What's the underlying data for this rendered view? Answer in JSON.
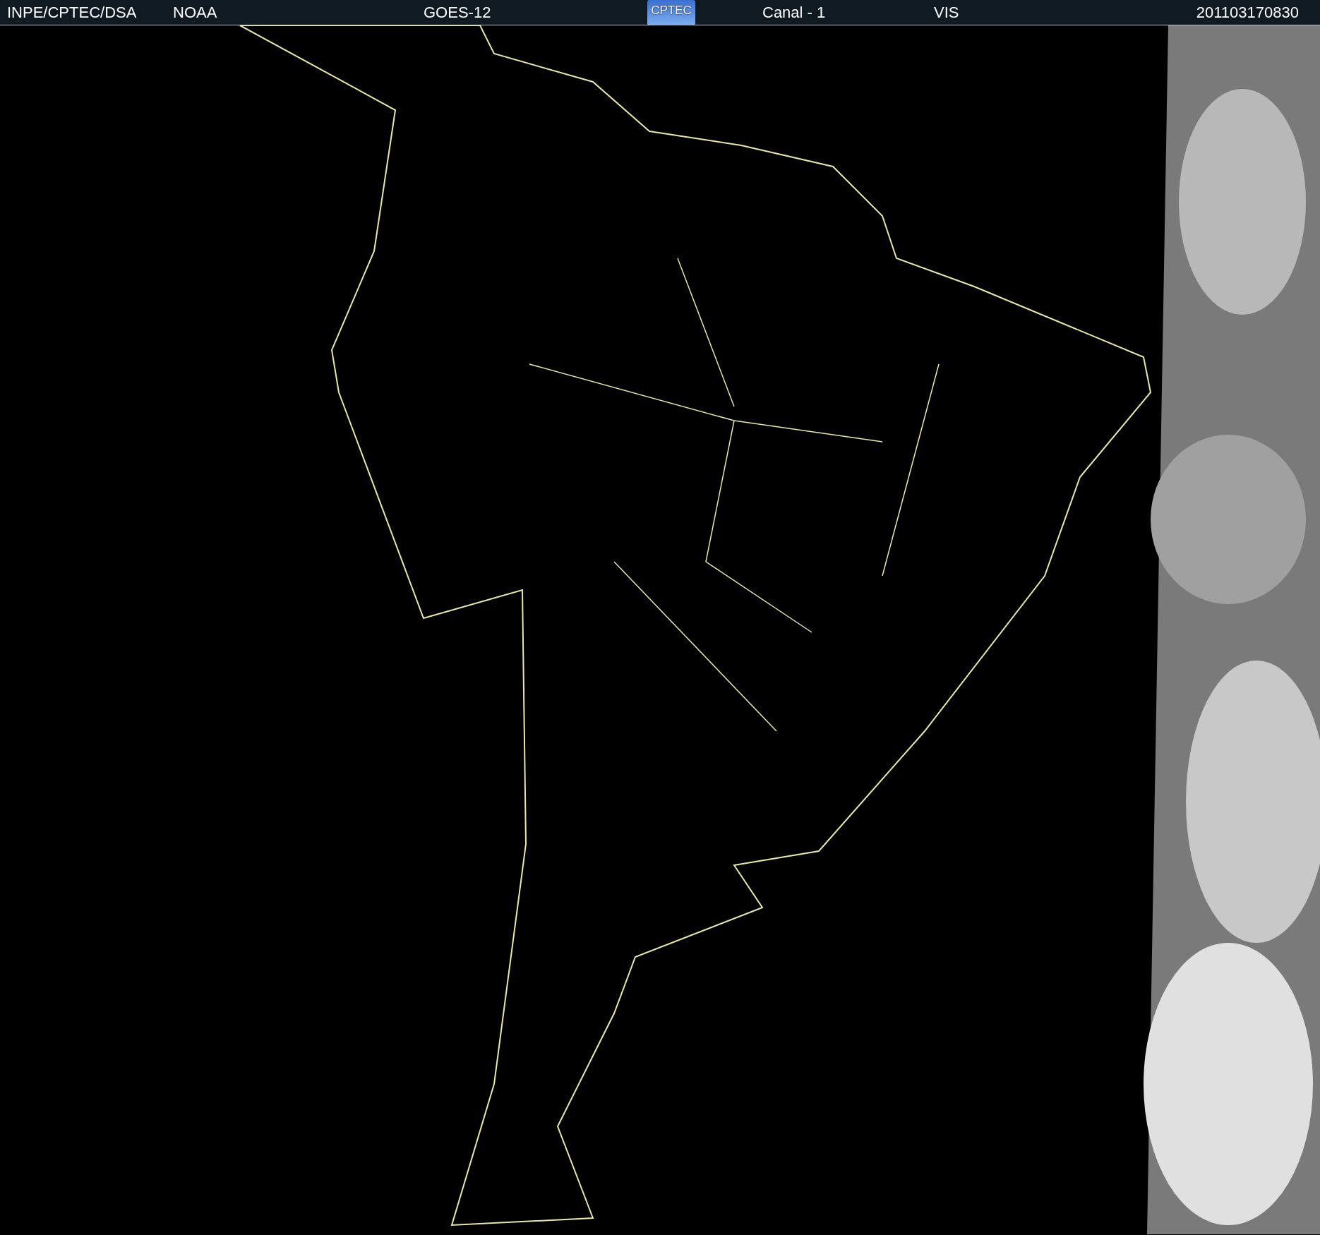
{
  "header": {
    "items": [
      {
        "kind": "text",
        "text": "INPE/CPTEC/DSA"
      },
      {
        "kind": "text",
        "text": "NOAA"
      },
      {
        "kind": "text",
        "text": "GOES-12"
      },
      {
        "kind": "logo",
        "text": "CPTEC"
      },
      {
        "kind": "text",
        "text": "Canal - 1"
      },
      {
        "kind": "text",
        "text": "VIS"
      },
      {
        "kind": "text",
        "text": "201103170830"
      }
    ]
  }
}
